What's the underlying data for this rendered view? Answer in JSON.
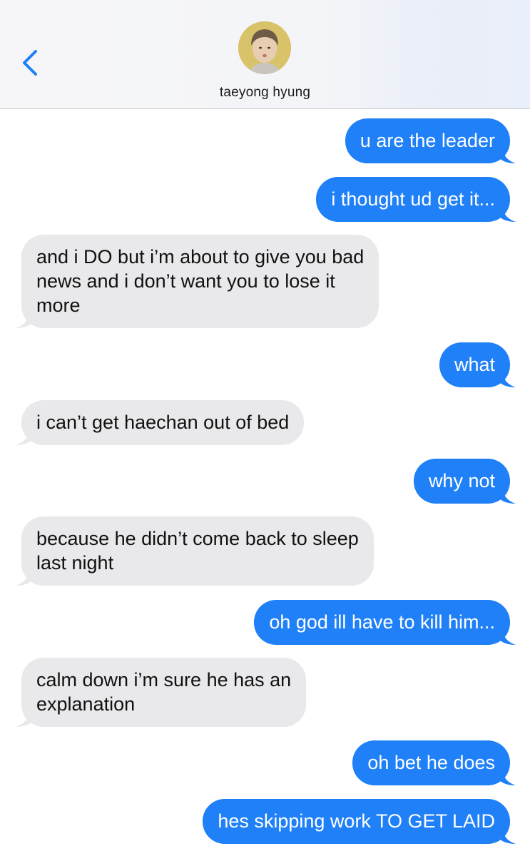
{
  "header": {
    "contact_name": "taeyong hyung",
    "back_icon": "chevron-left-icon",
    "accent_color": "#1f80f7"
  },
  "colors": {
    "sent_bubble": "#1f80f7",
    "received_bubble": "#e9e9eb"
  },
  "messages": [
    {
      "direction": "sent",
      "lines": [
        "u are the leader"
      ]
    },
    {
      "direction": "sent",
      "lines": [
        "i thought ud get it..."
      ]
    },
    {
      "direction": "received",
      "lines": [
        "and i DO but i’m about to give you bad",
        "news and i don’t want you to lose it",
        "more"
      ]
    },
    {
      "direction": "sent",
      "lines": [
        "what"
      ]
    },
    {
      "direction": "received",
      "lines": [
        "i can’t get haechan out of bed"
      ]
    },
    {
      "direction": "sent",
      "lines": [
        "why not"
      ]
    },
    {
      "direction": "received",
      "lines": [
        "because he didn’t come back to sleep",
        "last night"
      ]
    },
    {
      "direction": "sent",
      "lines": [
        "oh god ill have to kill him..."
      ]
    },
    {
      "direction": "received",
      "lines": [
        "calm down i’m sure he has an",
        "explanation"
      ]
    },
    {
      "direction": "sent",
      "lines": [
        "oh bet he does"
      ]
    },
    {
      "direction": "sent",
      "lines": [
        "hes skipping work TO GET LAID"
      ]
    }
  ]
}
